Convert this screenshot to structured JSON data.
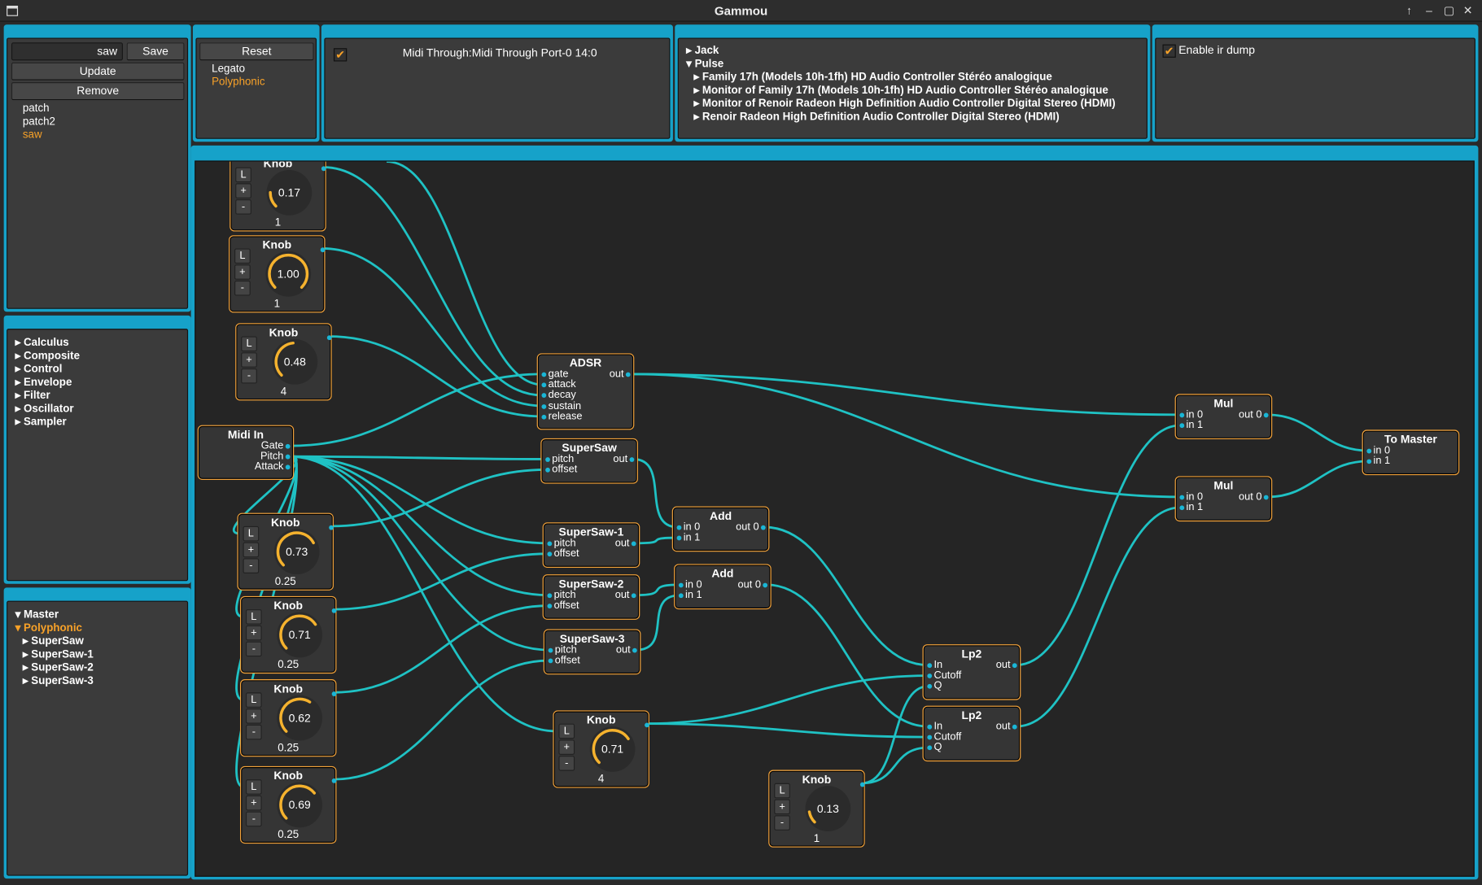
{
  "window": {
    "title": "Gammou",
    "controls": [
      "↑",
      "–",
      "▢",
      "✕"
    ]
  },
  "patches": {
    "name_value": "saw",
    "save": "Save",
    "update": "Update",
    "remove": "Remove",
    "list": [
      {
        "label": "patch"
      },
      {
        "label": "patch2"
      },
      {
        "label": "saw"
      }
    ]
  },
  "plugins": {
    "items": [
      "Calculus",
      "Composite",
      "Control",
      "Envelope",
      "Filter",
      "Oscillator",
      "Sampler"
    ]
  },
  "tree": {
    "master": "Master",
    "polyphonic": "Polyphonic",
    "children": [
      "SuperSaw",
      "SuperSaw-1",
      "SuperSaw-2",
      "SuperSaw-3"
    ]
  },
  "mode": {
    "reset": "Reset",
    "legato": "Legato",
    "polyphonic": "Polyphonic"
  },
  "midi": {
    "device": "Midi Through:Midi Through Port-0 14:0"
  },
  "audio": {
    "jack": "Jack",
    "pulse": "Pulse",
    "devices": [
      "Family 17h (Models 10h-1fh) HD Audio Controller Stéréo analogique",
      "Monitor of Family 17h (Models 10h-1fh) HD Audio Controller Stéréo analogique",
      "Monitor of Renoir Radeon High Definition Audio Controller Digital Stereo (HDMI)",
      "Renoir Radeon High Definition Audio Controller Digital Stereo (HDMI)"
    ]
  },
  "ir": {
    "label": "Enable ir dump"
  },
  "knob_buttons": {
    "l": "L",
    "plus": "+",
    "minus": "-"
  },
  "nodes": {
    "knob1": {
      "title": "Knob",
      "value": "0.17",
      "shape": "1",
      "level": 0.17
    },
    "knob2": {
      "title": "Knob",
      "value": "1.00",
      "shape": "1",
      "level": 1.0
    },
    "knob3": {
      "title": "Knob",
      "value": "0.48",
      "shape": "4",
      "level": 0.48
    },
    "knob4": {
      "title": "Knob",
      "value": "0.73",
      "shape": "0.25",
      "level": 0.73
    },
    "knob5": {
      "title": "Knob",
      "value": "0.71",
      "shape": "0.25",
      "level": 0.71
    },
    "knob6": {
      "title": "Knob",
      "value": "0.62",
      "shape": "0.25",
      "level": 0.62
    },
    "knob7": {
      "title": "Knob",
      "value": "0.69",
      "shape": "0.25",
      "level": 0.69
    },
    "knob8": {
      "title": "Knob",
      "value": "0.71",
      "shape": "4",
      "level": 0.71
    },
    "knob9": {
      "title": "Knob",
      "value": "0.13",
      "shape": "1",
      "level": 0.13
    },
    "adsr": {
      "title": "ADSR",
      "inputs": [
        "gate",
        "attack",
        "decay",
        "sustain",
        "release"
      ],
      "output": "out"
    },
    "midiin": {
      "title": "Midi In",
      "outputs": [
        "Gate",
        "Pitch",
        "Attack"
      ]
    },
    "supersaw": {
      "title": "SuperSaw",
      "inputs": [
        "pitch",
        "offset"
      ],
      "output": "out"
    },
    "supersaw1": {
      "title": "SuperSaw-1",
      "inputs": [
        "pitch",
        "offset"
      ],
      "output": "out"
    },
    "supersaw2": {
      "title": "SuperSaw-2",
      "inputs": [
        "pitch",
        "offset"
      ],
      "output": "out"
    },
    "supersaw3": {
      "title": "SuperSaw-3",
      "inputs": [
        "pitch",
        "offset"
      ],
      "output": "out"
    },
    "add1": {
      "title": "Add",
      "inputs": [
        "in 0",
        "in 1"
      ],
      "output": "out 0"
    },
    "add2": {
      "title": "Add",
      "inputs": [
        "in 0",
        "in 1"
      ],
      "output": "out 0"
    },
    "lp1": {
      "title": "Lp2",
      "inputs": [
        "In",
        "Cutoff",
        "Q"
      ],
      "output": "out"
    },
    "lp2": {
      "title": "Lp2",
      "inputs": [
        "In",
        "Cutoff",
        "Q"
      ],
      "output": "out"
    },
    "mul1": {
      "title": "Mul",
      "inputs": [
        "in 0",
        "in 1"
      ],
      "output": "out 0"
    },
    "mul2": {
      "title": "Mul",
      "inputs": [
        "in 0",
        "in 1"
      ],
      "output": "out 0"
    },
    "tomaster": {
      "title": "To Master",
      "inputs": [
        "in 0",
        "in 1"
      ]
    }
  },
  "colors": {
    "accent": "#16a2c9",
    "wire": "#1fc2c4",
    "node_border": "#f2a23a",
    "selected": "#f7a128",
    "knob_arc": "#f5b22e"
  }
}
